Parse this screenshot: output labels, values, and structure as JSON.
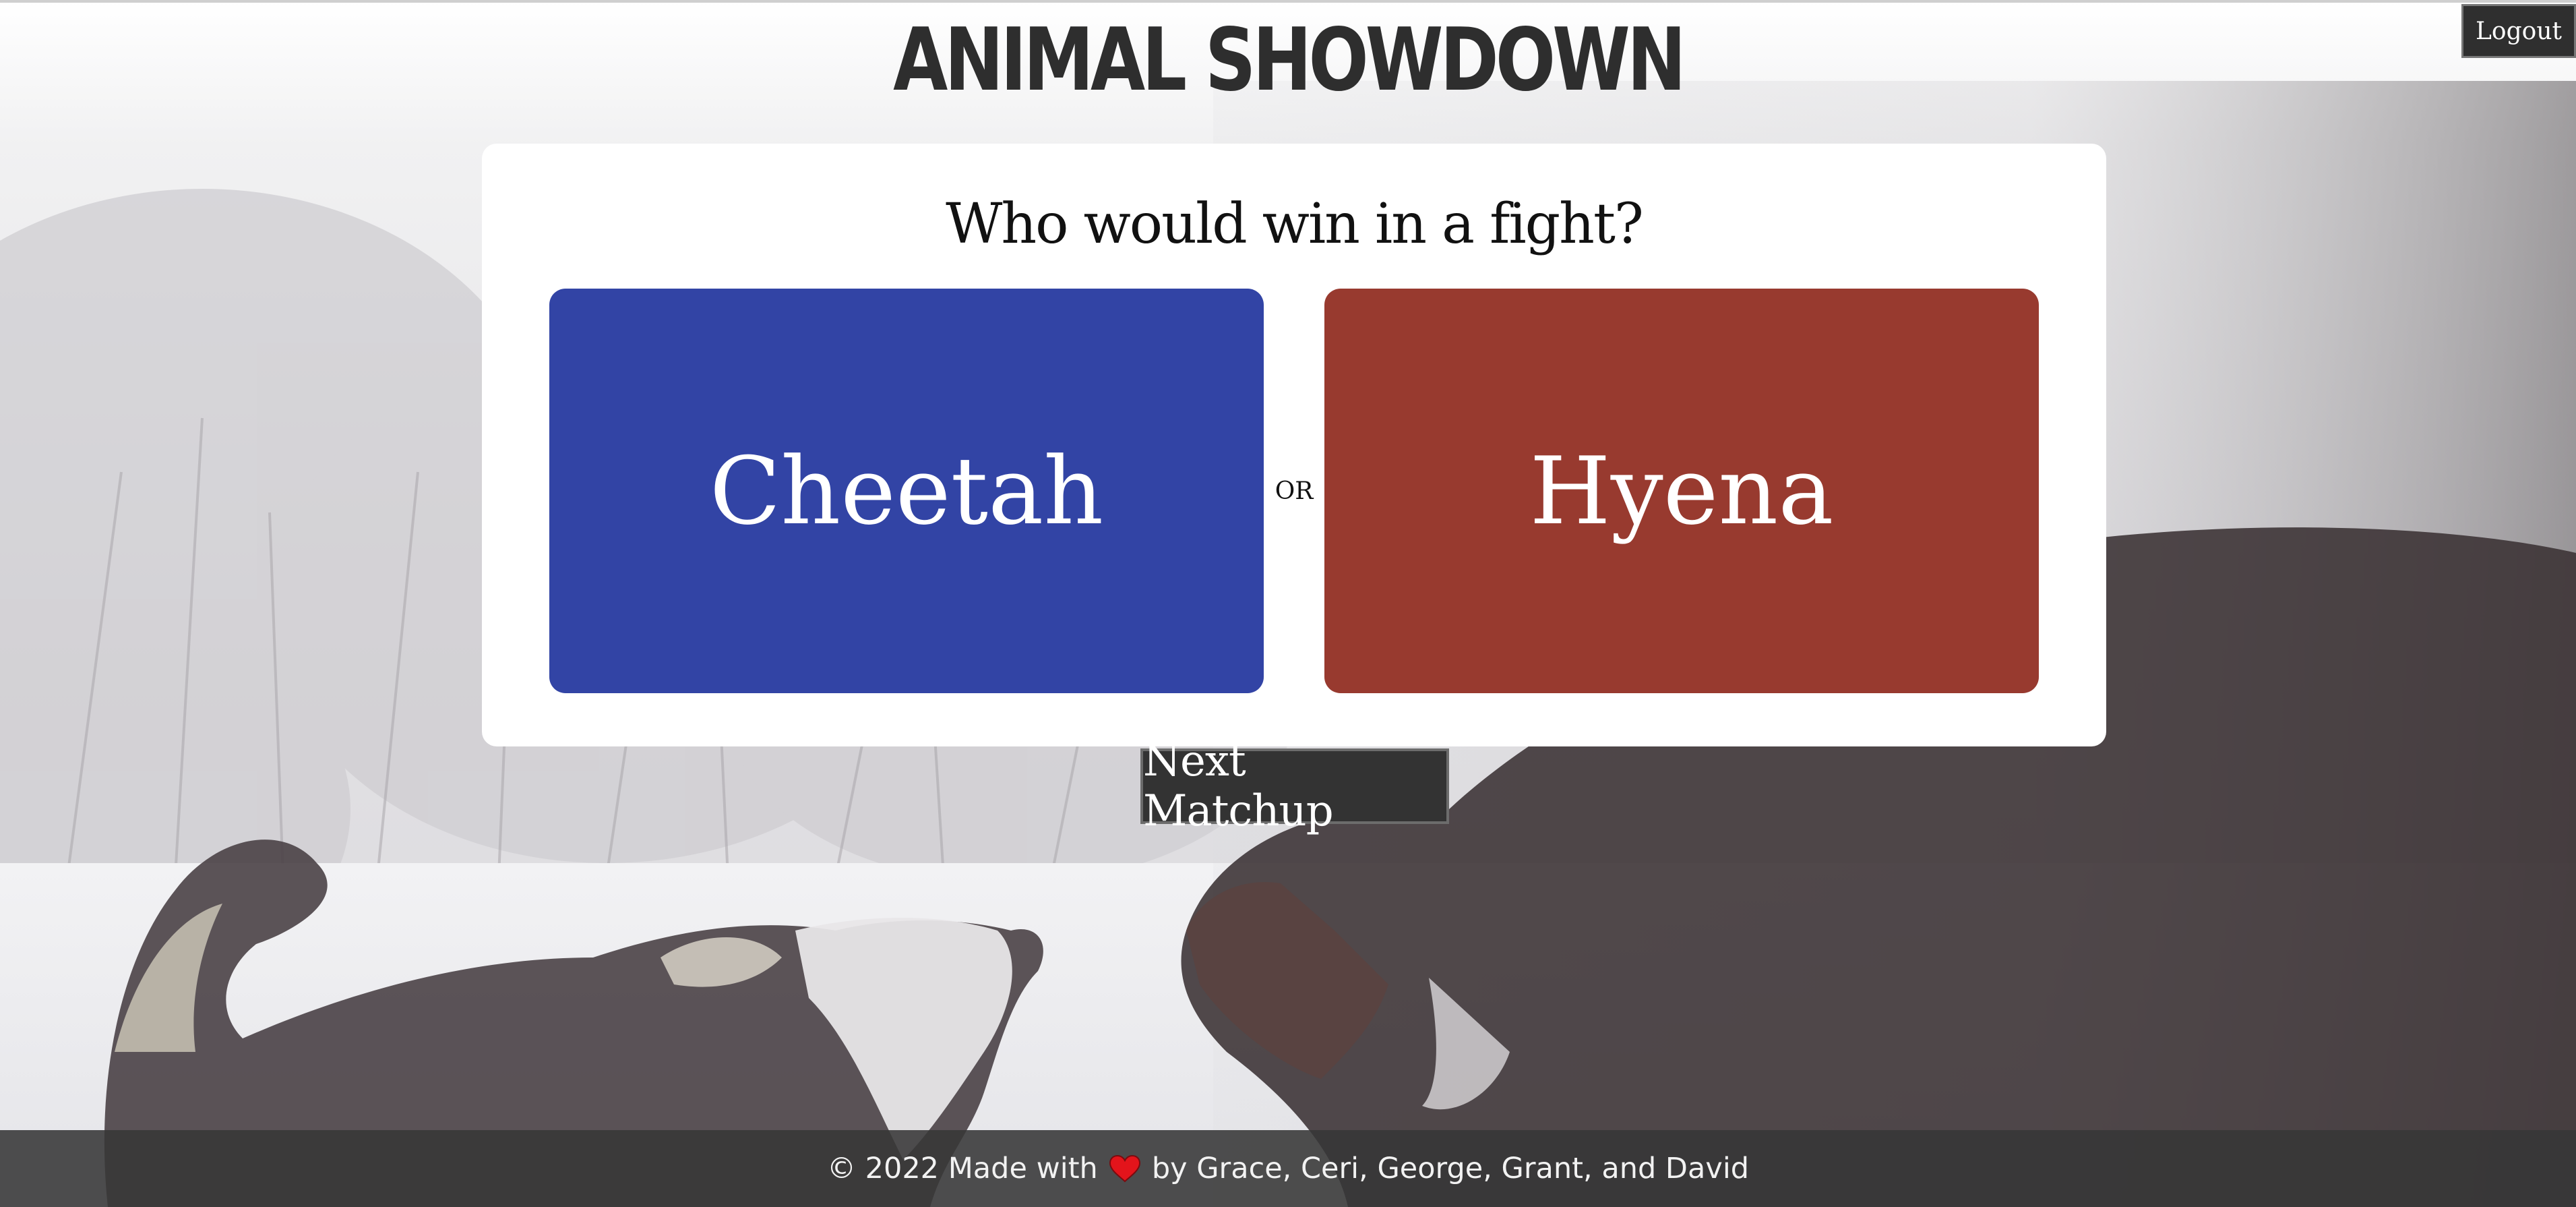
{
  "header": {
    "title": "ANIMAL SHOWDOWN",
    "logout_label": "Logout"
  },
  "card": {
    "question": "Who would win in a fight?",
    "choice_a": "Cheetah",
    "choice_b": "Hyena",
    "or_label": "OR"
  },
  "actions": {
    "next_label": "Next Matchup"
  },
  "footer": {
    "prefix": "© 2022 Made with",
    "suffix": "by Grace, Ceri, George, Grant, and David",
    "heart_icon": "heart-icon"
  },
  "colors": {
    "choice_a": "#3244a5",
    "choice_b": "#983a2f",
    "button_bg": "#333333",
    "footer_bg": "#373737"
  }
}
